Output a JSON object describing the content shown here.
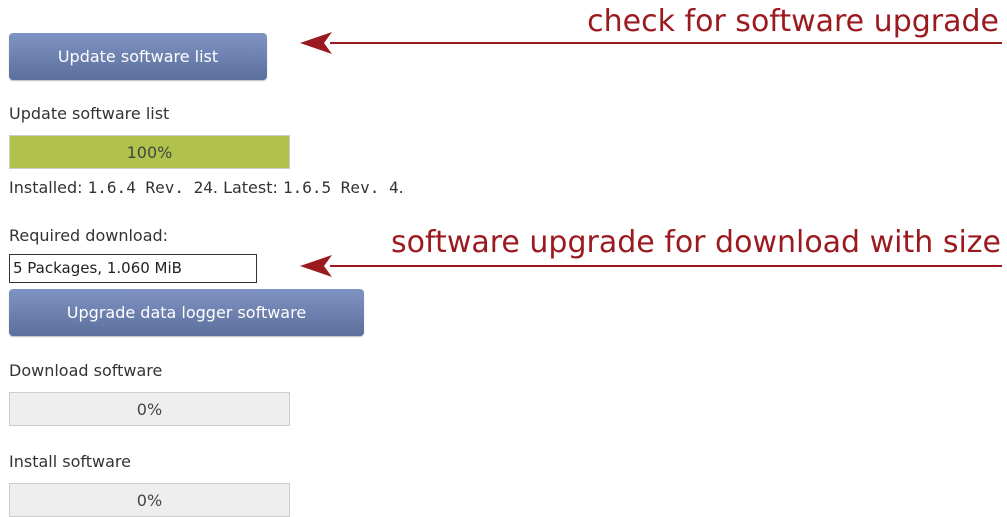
{
  "update_button": {
    "label": "Update software list"
  },
  "update_progress": {
    "label": "Update software list",
    "percent_text": "100%",
    "fraction": 1.0,
    "fill_color": "#b0c24c"
  },
  "versions": {
    "installed_label": "Installed:",
    "installed_value": "1.6.4 Rev. 24",
    "latest_label": ". Latest:",
    "latest_value": "1.6.5 Rev. 4",
    "end": "."
  },
  "required_download": {
    "label": "Required download:",
    "value": "5 Packages, 1.060 MiB"
  },
  "upgrade_button": {
    "label": "Upgrade data logger software"
  },
  "download_progress": {
    "label": "Download software",
    "percent_text": "0%",
    "fraction": 0.0
  },
  "install_progress": {
    "label": "Install software",
    "percent_text": "0%",
    "fraction": 0.0
  },
  "annotations": {
    "check": "check for software upgrade",
    "download": "software upgrade for download with size",
    "color": "#9b1a1f"
  },
  "colors": {
    "button_top": "#8094c4",
    "button_bottom": "#5c6f9c",
    "progress_fill": "#b0c24c",
    "progress_bg": "#eeeeee"
  }
}
